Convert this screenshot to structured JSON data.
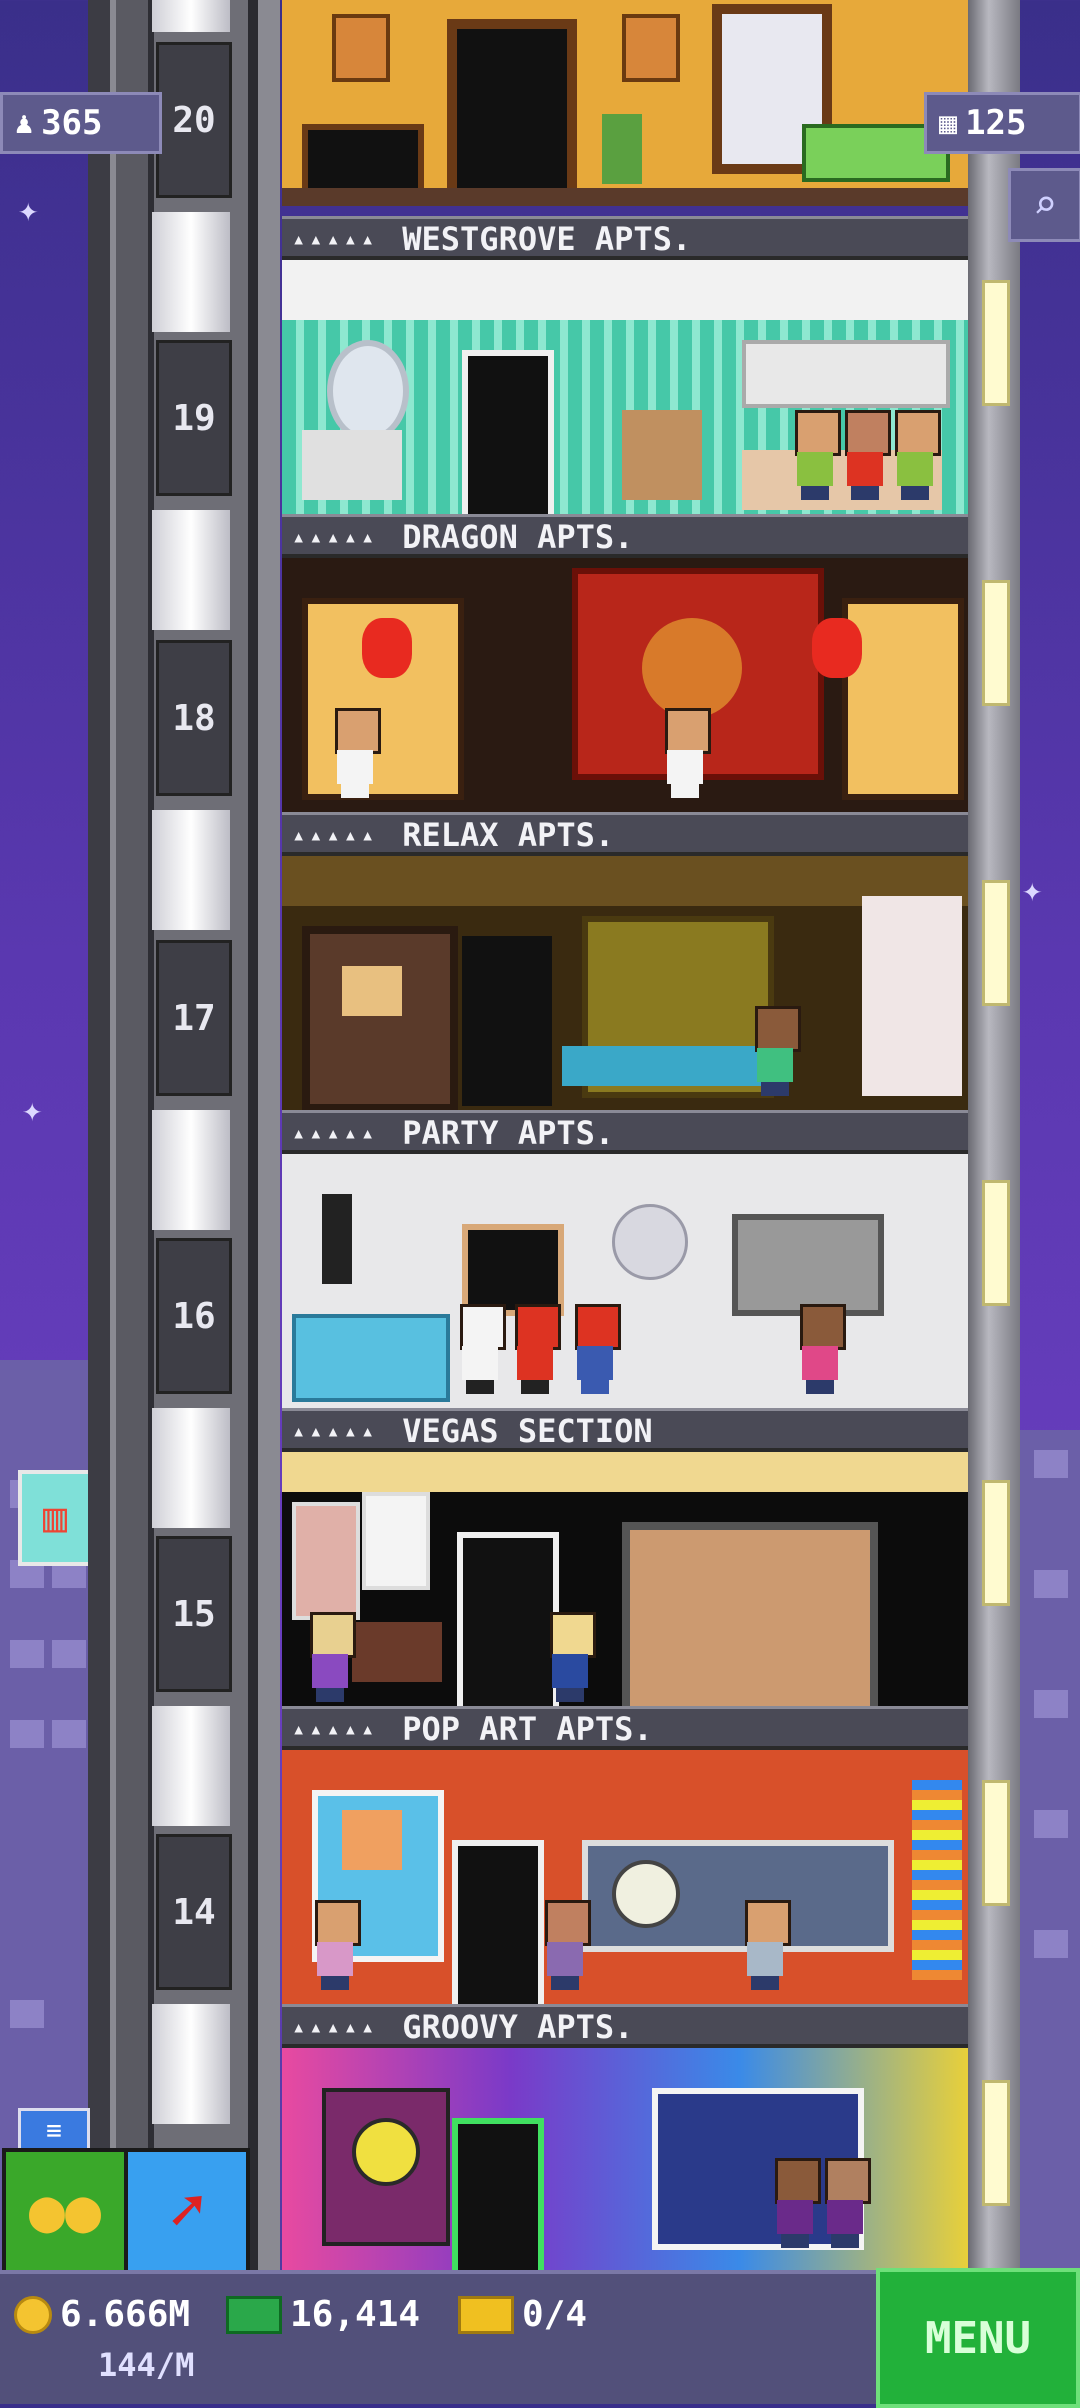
{
  "hud": {
    "population": "365",
    "floor_count": "125"
  },
  "floors": [
    {
      "number": "20",
      "name": "WESTGROVE APTS."
    },
    {
      "number": "19",
      "name": "DRAGON APTS."
    },
    {
      "number": "18",
      "name": "RELAX APTS."
    },
    {
      "number": "17",
      "name": "PARTY APTS."
    },
    {
      "number": "16",
      "name": "VEGAS SECTION"
    },
    {
      "number": "15",
      "name": "POP ART APTS."
    },
    {
      "number": "14",
      "name": "GROOVY APTS."
    }
  ],
  "floor_stars": "▴▴▴▴▴",
  "bottom": {
    "coins": "6.666M",
    "income_rate": "144/M",
    "bux": "16,414",
    "tickets": "0/4",
    "menu_label": "MENU"
  },
  "colors": {
    "sky": "#5a38b0",
    "menu_green": "#22b13a",
    "hud_bar": "#52507a"
  },
  "icons": [
    "person-icon",
    "building-icon",
    "search-icon",
    "coins-icon",
    "rocket-icon",
    "coin-icon",
    "bux-icon",
    "ticket-icon",
    "fries-icon",
    "chat-icon"
  ]
}
